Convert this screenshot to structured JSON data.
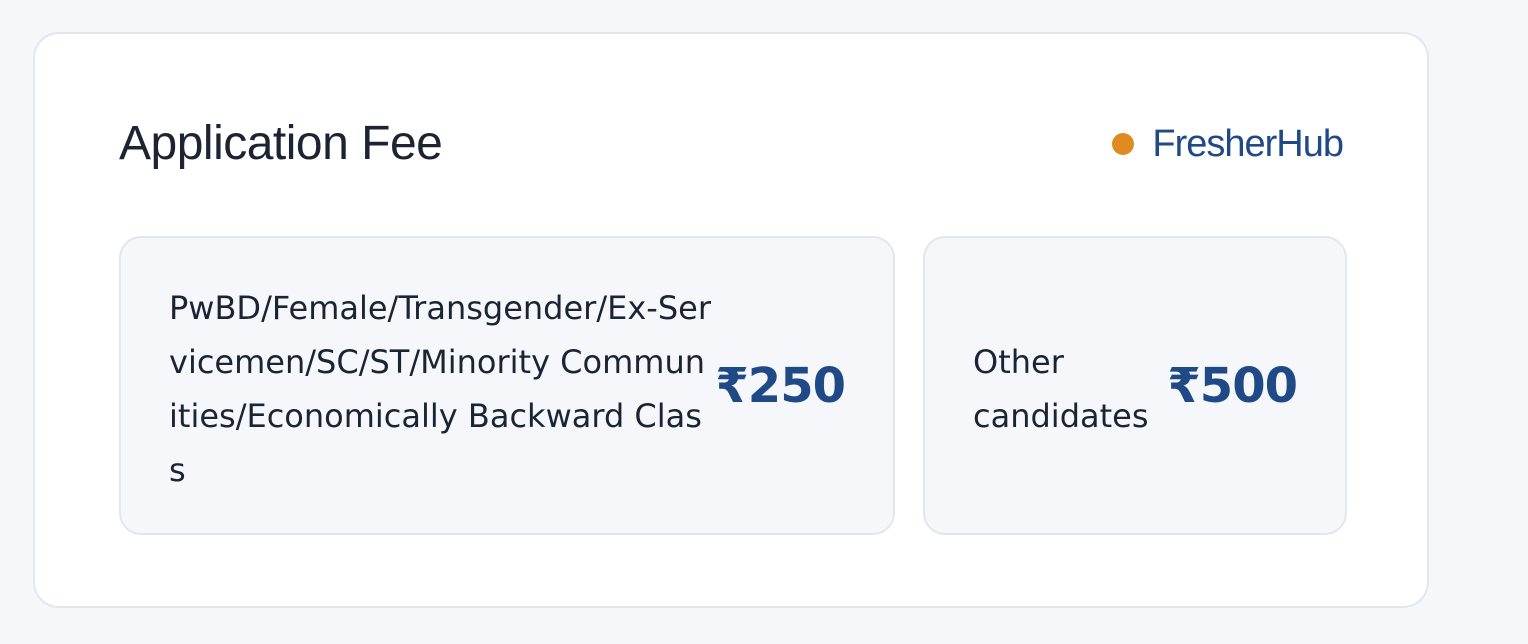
{
  "card": {
    "title": "Application Fee",
    "brand": {
      "name": "FresherHub",
      "dot_color": "#e08a22",
      "name_color": "#1f4a86"
    }
  },
  "fees": [
    {
      "category": "PwBD/Female/Transgender/Ex-Servicemen/SC/ST/Minority Communities/Economically Backward Class",
      "amount": "₹250"
    },
    {
      "category": "Other candidates",
      "amount": "₹500"
    }
  ],
  "colors": {
    "page_background": "#f5f7fb",
    "card_background": "#ffffff",
    "fee_box_background": "#f5f7fb",
    "border": "#e3e6ee",
    "text": "#1c2434",
    "accent": "#1f4a86"
  }
}
